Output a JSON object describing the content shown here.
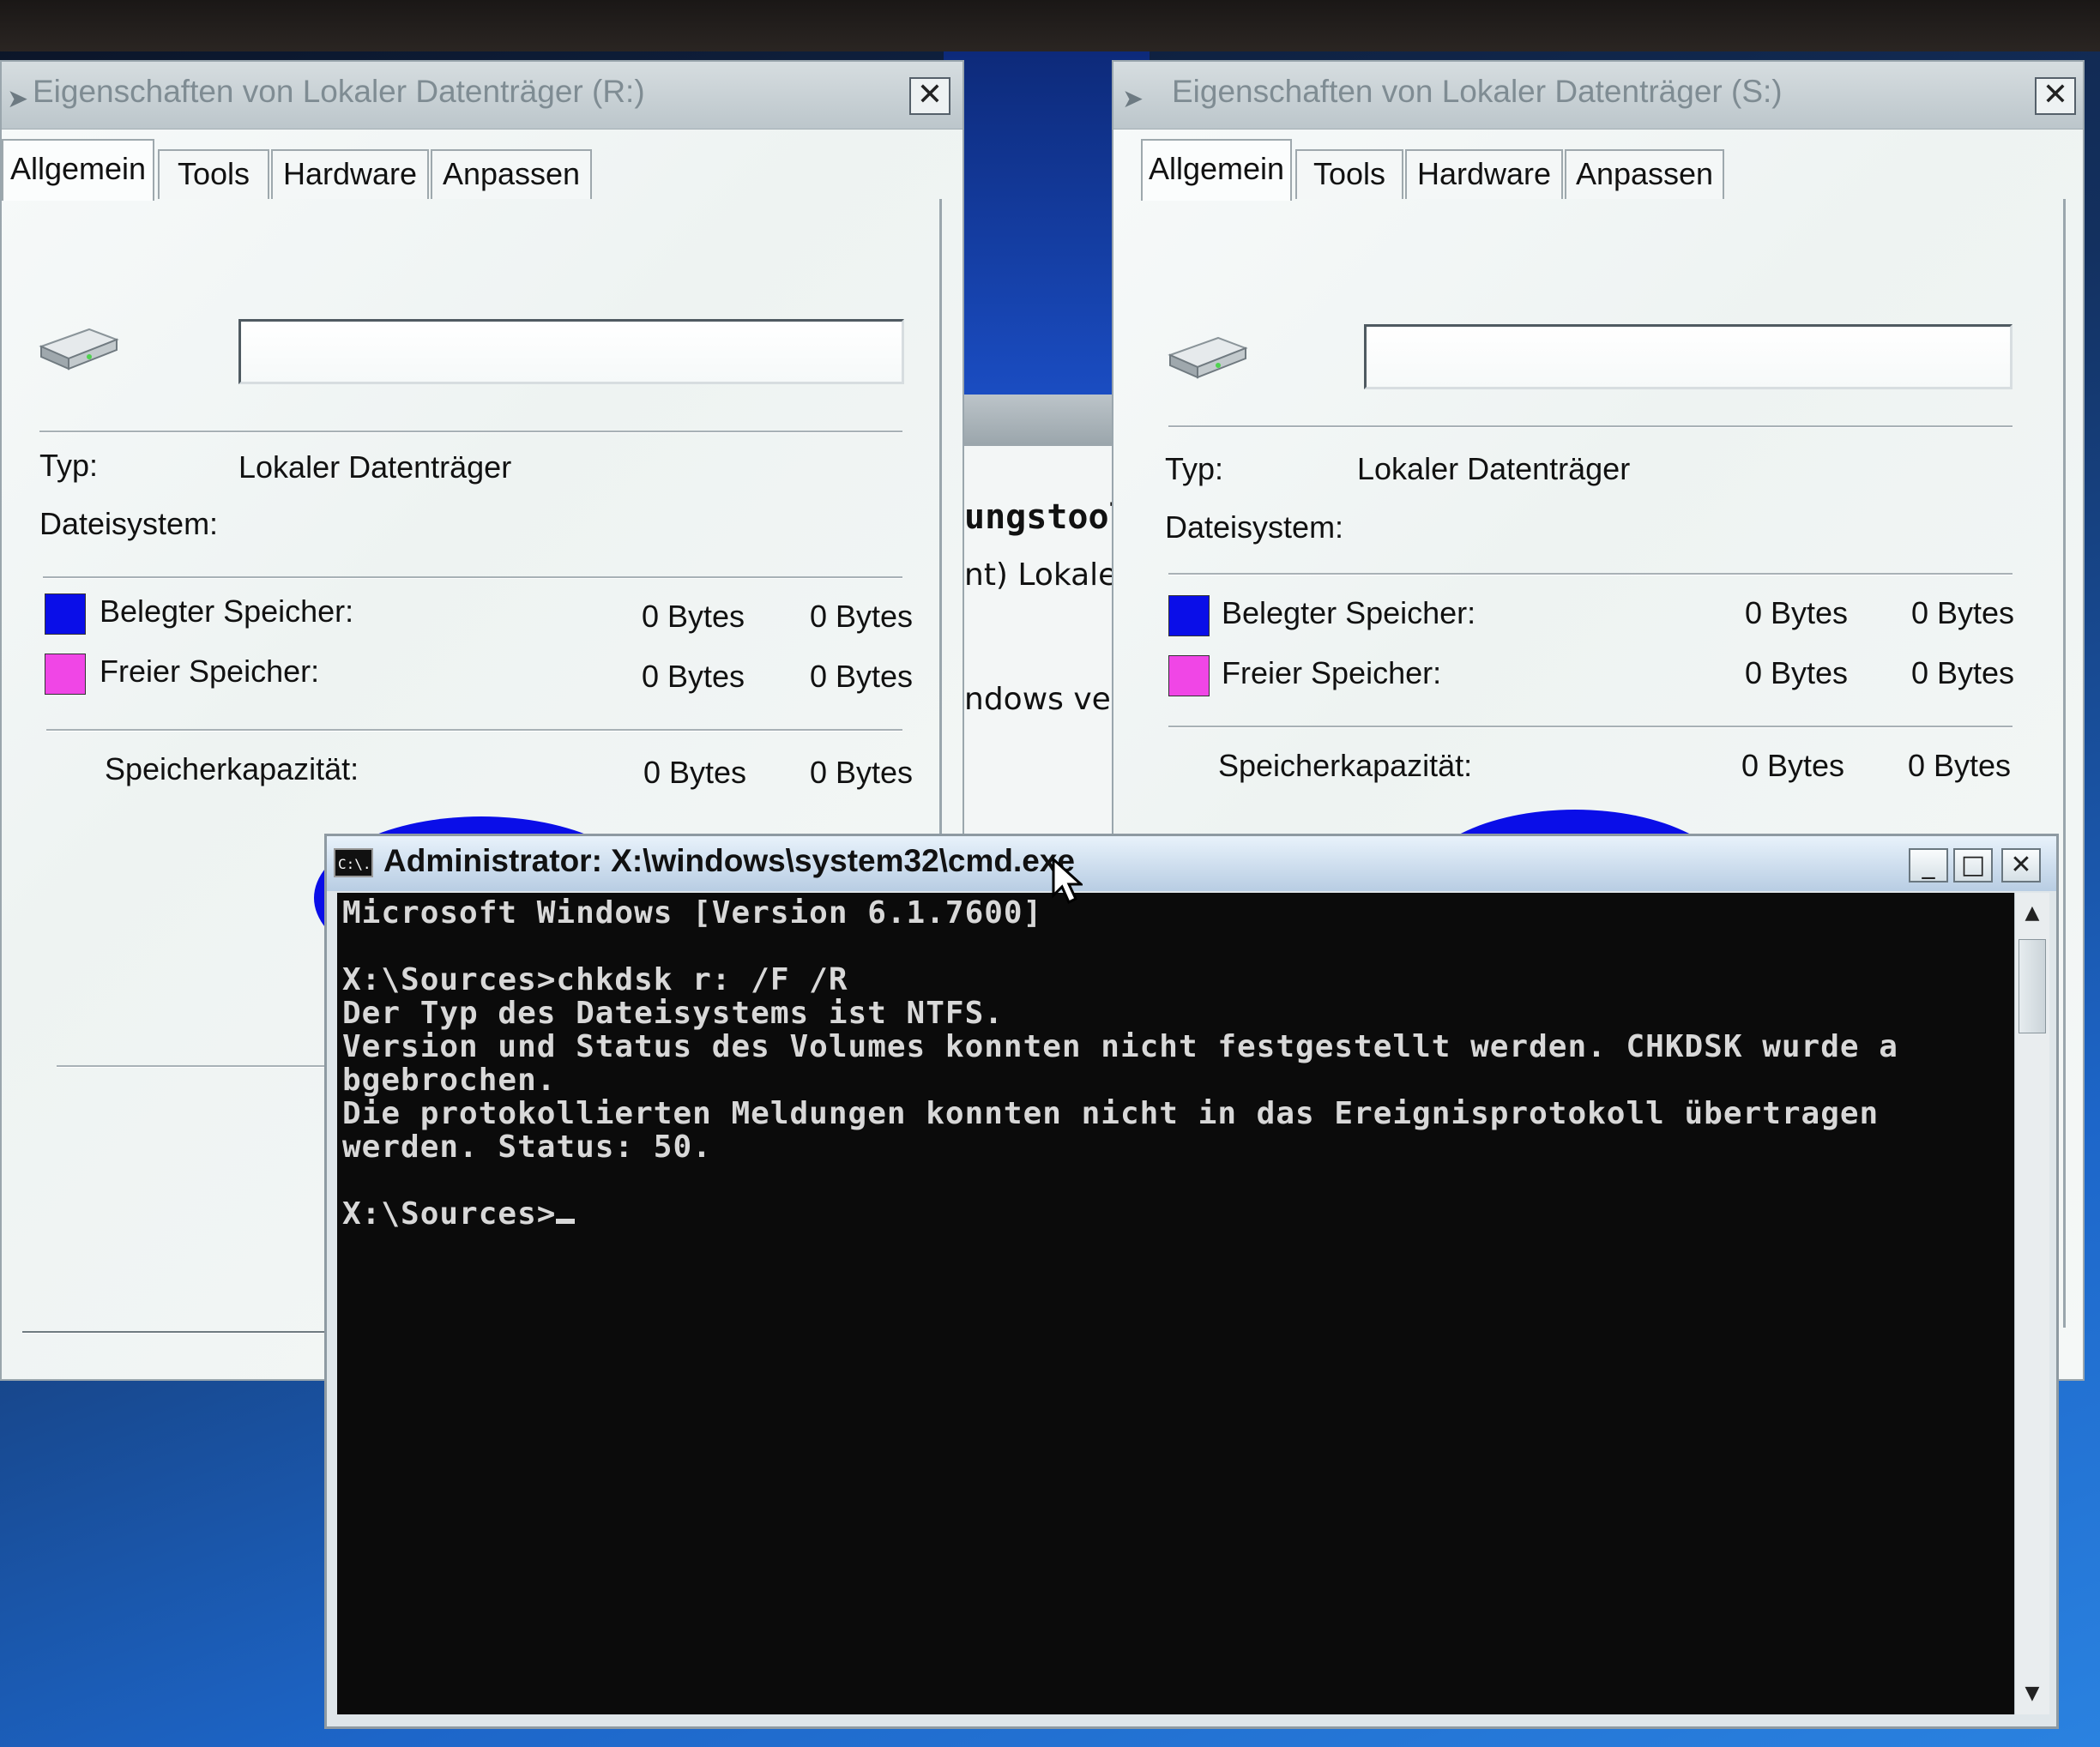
{
  "background_window": {
    "lines": [
      "ungstool",
      "nt) Lokaler",
      "ndows verl"
    ]
  },
  "dialog_r": {
    "title": "Eigenschaften von Lokaler Datenträger (R:)",
    "tabs": [
      "Allgemein",
      "Tools",
      "Hardware",
      "Anpassen"
    ],
    "active_tab": "Allgemein",
    "name_value": "",
    "type_label": "Typ:",
    "type_value": "Lokaler Datenträger",
    "fs_label": "Dateisystem:",
    "fs_value": "",
    "used_label": "Belegter Speicher:",
    "used_bytes": "0 Bytes",
    "used_size": "0 Bytes",
    "free_label": "Freier Speicher:",
    "free_bytes": "0 Bytes",
    "free_size": "0 Bytes",
    "capacity_label": "Speicherkapazität:",
    "capacity_bytes": "0 Bytes",
    "capacity_size": "0 Bytes",
    "used_color": "#0a0ee8",
    "free_color": "#f046e6"
  },
  "dialog_s": {
    "title": "Eigenschaften von Lokaler Datenträger (S:)",
    "tabs": [
      "Allgemein",
      "Tools",
      "Hardware",
      "Anpassen"
    ],
    "active_tab": "Allgemein",
    "name_value": "",
    "type_label": "Typ:",
    "type_value": "Lokaler Datenträger",
    "fs_label": "Dateisystem:",
    "fs_value": "",
    "used_label": "Belegter Speicher:",
    "used_bytes": "0 Bytes",
    "used_size": "0 Bytes",
    "free_label": "Freier Speicher:",
    "free_bytes": "0 Bytes",
    "free_size": "0 Bytes",
    "capacity_label": "Speicherkapazität:",
    "capacity_bytes": "0 Bytes",
    "capacity_size": "0 Bytes",
    "used_color": "#0a0ee8",
    "free_color": "#f046e6"
  },
  "cmd": {
    "title": "Administrator: X:\\windows\\system32\\cmd.exe",
    "icon_text": "C:\\.",
    "minimize": "_",
    "maximize": "□",
    "close": "✕",
    "lines": [
      "Microsoft Windows [Version 6.1.7600]",
      "",
      "X:\\Sources>chkdsk r: /F /R",
      "Der Typ des Dateisystems ist NTFS.",
      "Version und Status des Volumes konnten nicht festgestellt werden. CHKDSK wurde a",
      "bgebrochen.",
      "Die protokollierten Meldungen konnten nicht in das Ereignisprotokoll übertragen",
      "werden. Status: 50.",
      "",
      "X:\\Sources>"
    ]
  },
  "icons": {
    "drive": "hard-drive-icon",
    "close": "close-icon",
    "scroll_up": "scroll-up-arrow-icon",
    "scroll_down": "scroll-down-arrow-icon",
    "pointer": "mouse-pointer-icon"
  }
}
